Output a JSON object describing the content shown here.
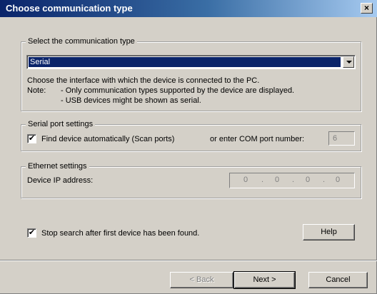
{
  "window": {
    "title": "Choose communication type",
    "close_glyph": "×"
  },
  "comm_type": {
    "legend": "Select the communication type",
    "selected": "Serial",
    "desc": "Choose the interface with which the device is connected to the PC.",
    "note_label": "Note:",
    "note_1": "- Only communication types supported by the device are displayed.",
    "note_2": "- USB devices might be shown as serial."
  },
  "serial": {
    "legend": "Serial port settings",
    "auto_checked": true,
    "auto_label": "Find device automatically (Scan ports)",
    "com_label": "or enter COM port number:",
    "com_value": "6"
  },
  "ethernet": {
    "legend": "Ethernet settings",
    "ip_label": "Device IP address:",
    "ip_octets": [
      "0",
      "0",
      "0",
      "0"
    ],
    "ip_dot": "."
  },
  "options": {
    "stop_checked": true,
    "stop_label": "Stop search after first device has been found."
  },
  "buttons": {
    "help": "Help",
    "back": "< Back",
    "next": "Next >",
    "cancel": "Cancel"
  },
  "check_glyph": "✔",
  "colors": {
    "selection": "#0a246a",
    "title_start": "#0a246a",
    "title_end": "#a6caf0",
    "face": "#d4d0c8"
  },
  "icons": {
    "close": "close-icon",
    "dropdown": "chevron-down-icon",
    "check": "check-icon"
  }
}
